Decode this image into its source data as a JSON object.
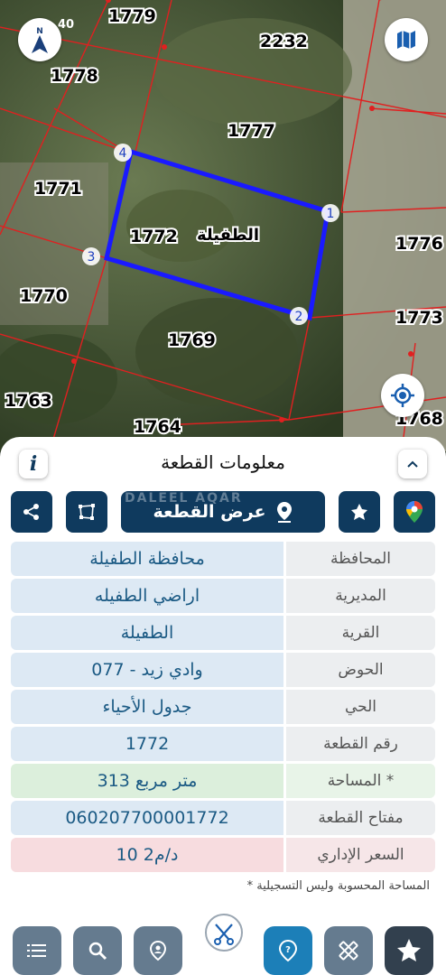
{
  "statusbar": {
    "time": "40"
  },
  "map": {
    "plots": [
      {
        "id": "p1779",
        "label": "1779"
      },
      {
        "id": "p2232",
        "label": "2232"
      },
      {
        "id": "p1778",
        "label": "1778"
      },
      {
        "id": "p1777",
        "label": "1777"
      },
      {
        "id": "p1771",
        "label": "1771"
      },
      {
        "id": "p1772",
        "label": "1772"
      },
      {
        "id": "p1776",
        "label": "1776"
      },
      {
        "id": "p1770",
        "label": "1770"
      },
      {
        "id": "p1773",
        "label": "1773"
      },
      {
        "id": "p1769",
        "label": "1769"
      },
      {
        "id": "p1763",
        "label": "1763"
      },
      {
        "id": "p1764",
        "label": "1764"
      },
      {
        "id": "p1768",
        "label": "1768"
      }
    ],
    "area_name": "الطفيلة",
    "corners": [
      "1",
      "2",
      "3",
      "4"
    ],
    "north_label": "N"
  },
  "panel": {
    "title": "معلومات القطعة",
    "show_plot_label": "عرض القطعة",
    "watermark": "DALEEL AQAR",
    "rows": [
      {
        "label": "المحافظة",
        "value": "محافظة الطفيلة",
        "style": ""
      },
      {
        "label": "المديرية",
        "value": "اراضي الطفيله",
        "style": ""
      },
      {
        "label": "القرية",
        "value": "الطفيلة",
        "style": ""
      },
      {
        "label": "الحوض",
        "value": "وادي زيد - 077",
        "style": ""
      },
      {
        "label": "الحي",
        "value": "جدول الأحياء",
        "style": ""
      },
      {
        "label": "رقم القطعة",
        "value": "1772",
        "style": ""
      },
      {
        "label": "المساحة *",
        "value": "313  متر مربع",
        "style": "green"
      },
      {
        "label": "مفتاح القطعة",
        "value": "060207700001772",
        "style": ""
      },
      {
        "label": "السعر الإداري",
        "value": "10 د/م2",
        "style": "red"
      }
    ],
    "note": "* المساحة المحسوبة وليس التسجيلية"
  },
  "colors": {
    "primary": "#0f3a5e",
    "boundary": "#1a1aff",
    "accent": "#1c7fb8"
  }
}
